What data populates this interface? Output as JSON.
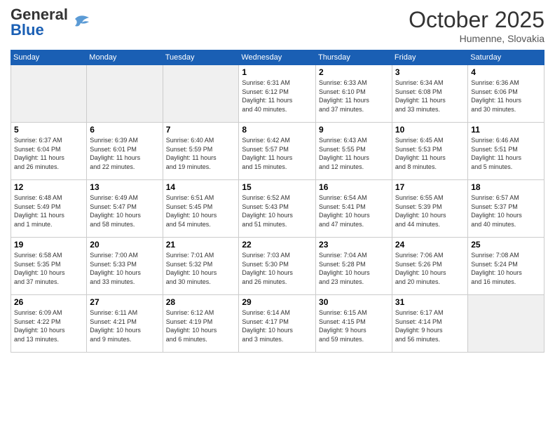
{
  "header": {
    "logo_general": "General",
    "logo_blue": "Blue",
    "month": "October 2025",
    "location": "Humenne, Slovakia"
  },
  "weekdays": [
    "Sunday",
    "Monday",
    "Tuesday",
    "Wednesday",
    "Thursday",
    "Friday",
    "Saturday"
  ],
  "weeks": [
    [
      {
        "day": "",
        "info": ""
      },
      {
        "day": "",
        "info": ""
      },
      {
        "day": "",
        "info": ""
      },
      {
        "day": "1",
        "info": "Sunrise: 6:31 AM\nSunset: 6:12 PM\nDaylight: 11 hours\nand 40 minutes."
      },
      {
        "day": "2",
        "info": "Sunrise: 6:33 AM\nSunset: 6:10 PM\nDaylight: 11 hours\nand 37 minutes."
      },
      {
        "day": "3",
        "info": "Sunrise: 6:34 AM\nSunset: 6:08 PM\nDaylight: 11 hours\nand 33 minutes."
      },
      {
        "day": "4",
        "info": "Sunrise: 6:36 AM\nSunset: 6:06 PM\nDaylight: 11 hours\nand 30 minutes."
      }
    ],
    [
      {
        "day": "5",
        "info": "Sunrise: 6:37 AM\nSunset: 6:04 PM\nDaylight: 11 hours\nand 26 minutes."
      },
      {
        "day": "6",
        "info": "Sunrise: 6:39 AM\nSunset: 6:01 PM\nDaylight: 11 hours\nand 22 minutes."
      },
      {
        "day": "7",
        "info": "Sunrise: 6:40 AM\nSunset: 5:59 PM\nDaylight: 11 hours\nand 19 minutes."
      },
      {
        "day": "8",
        "info": "Sunrise: 6:42 AM\nSunset: 5:57 PM\nDaylight: 11 hours\nand 15 minutes."
      },
      {
        "day": "9",
        "info": "Sunrise: 6:43 AM\nSunset: 5:55 PM\nDaylight: 11 hours\nand 12 minutes."
      },
      {
        "day": "10",
        "info": "Sunrise: 6:45 AM\nSunset: 5:53 PM\nDaylight: 11 hours\nand 8 minutes."
      },
      {
        "day": "11",
        "info": "Sunrise: 6:46 AM\nSunset: 5:51 PM\nDaylight: 11 hours\nand 5 minutes."
      }
    ],
    [
      {
        "day": "12",
        "info": "Sunrise: 6:48 AM\nSunset: 5:49 PM\nDaylight: 11 hours\nand 1 minute."
      },
      {
        "day": "13",
        "info": "Sunrise: 6:49 AM\nSunset: 5:47 PM\nDaylight: 10 hours\nand 58 minutes."
      },
      {
        "day": "14",
        "info": "Sunrise: 6:51 AM\nSunset: 5:45 PM\nDaylight: 10 hours\nand 54 minutes."
      },
      {
        "day": "15",
        "info": "Sunrise: 6:52 AM\nSunset: 5:43 PM\nDaylight: 10 hours\nand 51 minutes."
      },
      {
        "day": "16",
        "info": "Sunrise: 6:54 AM\nSunset: 5:41 PM\nDaylight: 10 hours\nand 47 minutes."
      },
      {
        "day": "17",
        "info": "Sunrise: 6:55 AM\nSunset: 5:39 PM\nDaylight: 10 hours\nand 44 minutes."
      },
      {
        "day": "18",
        "info": "Sunrise: 6:57 AM\nSunset: 5:37 PM\nDaylight: 10 hours\nand 40 minutes."
      }
    ],
    [
      {
        "day": "19",
        "info": "Sunrise: 6:58 AM\nSunset: 5:35 PM\nDaylight: 10 hours\nand 37 minutes."
      },
      {
        "day": "20",
        "info": "Sunrise: 7:00 AM\nSunset: 5:33 PM\nDaylight: 10 hours\nand 33 minutes."
      },
      {
        "day": "21",
        "info": "Sunrise: 7:01 AM\nSunset: 5:32 PM\nDaylight: 10 hours\nand 30 minutes."
      },
      {
        "day": "22",
        "info": "Sunrise: 7:03 AM\nSunset: 5:30 PM\nDaylight: 10 hours\nand 26 minutes."
      },
      {
        "day": "23",
        "info": "Sunrise: 7:04 AM\nSunset: 5:28 PM\nDaylight: 10 hours\nand 23 minutes."
      },
      {
        "day": "24",
        "info": "Sunrise: 7:06 AM\nSunset: 5:26 PM\nDaylight: 10 hours\nand 20 minutes."
      },
      {
        "day": "25",
        "info": "Sunrise: 7:08 AM\nSunset: 5:24 PM\nDaylight: 10 hours\nand 16 minutes."
      }
    ],
    [
      {
        "day": "26",
        "info": "Sunrise: 6:09 AM\nSunset: 4:22 PM\nDaylight: 10 hours\nand 13 minutes."
      },
      {
        "day": "27",
        "info": "Sunrise: 6:11 AM\nSunset: 4:21 PM\nDaylight: 10 hours\nand 9 minutes."
      },
      {
        "day": "28",
        "info": "Sunrise: 6:12 AM\nSunset: 4:19 PM\nDaylight: 10 hours\nand 6 minutes."
      },
      {
        "day": "29",
        "info": "Sunrise: 6:14 AM\nSunset: 4:17 PM\nDaylight: 10 hours\nand 3 minutes."
      },
      {
        "day": "30",
        "info": "Sunrise: 6:15 AM\nSunset: 4:15 PM\nDaylight: 9 hours\nand 59 minutes."
      },
      {
        "day": "31",
        "info": "Sunrise: 6:17 AM\nSunset: 4:14 PM\nDaylight: 9 hours\nand 56 minutes."
      },
      {
        "day": "",
        "info": ""
      }
    ]
  ]
}
